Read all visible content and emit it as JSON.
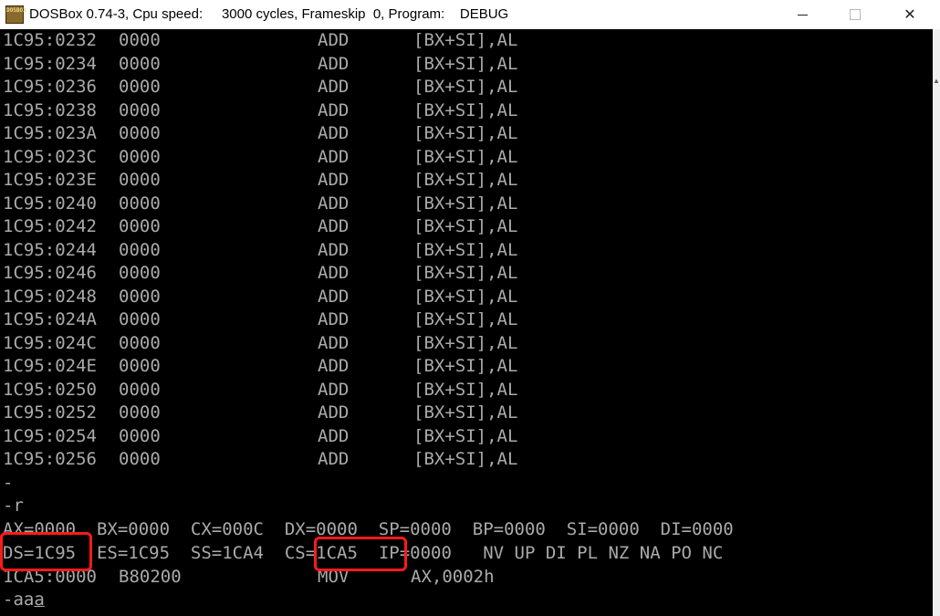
{
  "window": {
    "icon_label": [
      "DOS",
      "BOX",
      "",
      ""
    ],
    "title": "DOSBox 0.74-3, Cpu speed:     3000 cycles, Frameskip  0, Program:    DEBUG",
    "minimize_symbol": "",
    "maximize_symbol": "",
    "close_symbol": "✕"
  },
  "console": {
    "disassembly": [
      {
        "addr": "1C95:0232",
        "bytes": "0000",
        "op": "ADD",
        "args": "[BX+SI],AL"
      },
      {
        "addr": "1C95:0234",
        "bytes": "0000",
        "op": "ADD",
        "args": "[BX+SI],AL"
      },
      {
        "addr": "1C95:0236",
        "bytes": "0000",
        "op": "ADD",
        "args": "[BX+SI],AL"
      },
      {
        "addr": "1C95:0238",
        "bytes": "0000",
        "op": "ADD",
        "args": "[BX+SI],AL"
      },
      {
        "addr": "1C95:023A",
        "bytes": "0000",
        "op": "ADD",
        "args": "[BX+SI],AL"
      },
      {
        "addr": "1C95:023C",
        "bytes": "0000",
        "op": "ADD",
        "args": "[BX+SI],AL"
      },
      {
        "addr": "1C95:023E",
        "bytes": "0000",
        "op": "ADD",
        "args": "[BX+SI],AL"
      },
      {
        "addr": "1C95:0240",
        "bytes": "0000",
        "op": "ADD",
        "args": "[BX+SI],AL"
      },
      {
        "addr": "1C95:0242",
        "bytes": "0000",
        "op": "ADD",
        "args": "[BX+SI],AL"
      },
      {
        "addr": "1C95:0244",
        "bytes": "0000",
        "op": "ADD",
        "args": "[BX+SI],AL"
      },
      {
        "addr": "1C95:0246",
        "bytes": "0000",
        "op": "ADD",
        "args": "[BX+SI],AL"
      },
      {
        "addr": "1C95:0248",
        "bytes": "0000",
        "op": "ADD",
        "args": "[BX+SI],AL"
      },
      {
        "addr": "1C95:024A",
        "bytes": "0000",
        "op": "ADD",
        "args": "[BX+SI],AL"
      },
      {
        "addr": "1C95:024C",
        "bytes": "0000",
        "op": "ADD",
        "args": "[BX+SI],AL"
      },
      {
        "addr": "1C95:024E",
        "bytes": "0000",
        "op": "ADD",
        "args": "[BX+SI],AL"
      },
      {
        "addr": "1C95:0250",
        "bytes": "0000",
        "op": "ADD",
        "args": "[BX+SI],AL"
      },
      {
        "addr": "1C95:0252",
        "bytes": "0000",
        "op": "ADD",
        "args": "[BX+SI],AL"
      },
      {
        "addr": "1C95:0254",
        "bytes": "0000",
        "op": "ADD",
        "args": "[BX+SI],AL"
      },
      {
        "addr": "1C95:0256",
        "bytes": "0000",
        "op": "ADD",
        "args": "[BX+SI],AL"
      }
    ],
    "prompt_empty": "-",
    "command_r": "-r",
    "registers_line1": "AX=0000  BX=0000  CX=000C  DX=0000  SP=0000  BP=0000  SI=0000  DI=0000",
    "registers_line2": {
      "ds": "DS=1C95",
      "es_ss": "  ES=1C95  SS=1CA4  ",
      "cs": "CS=1CA5",
      "rest": "  IP=0000   NV UP DI PL NZ NA PO NC"
    },
    "next_instruction": {
      "addr": "1CA5:0000",
      "bytes": "B80200",
      "op": "MOV",
      "args": "AX,0002h"
    },
    "input_line": {
      "typed": "-aa",
      "cursor_char": "a"
    }
  },
  "colors": {
    "console_bg": "#000000",
    "console_text": "#aaaaaa",
    "highlight": "#ff1a1a"
  }
}
